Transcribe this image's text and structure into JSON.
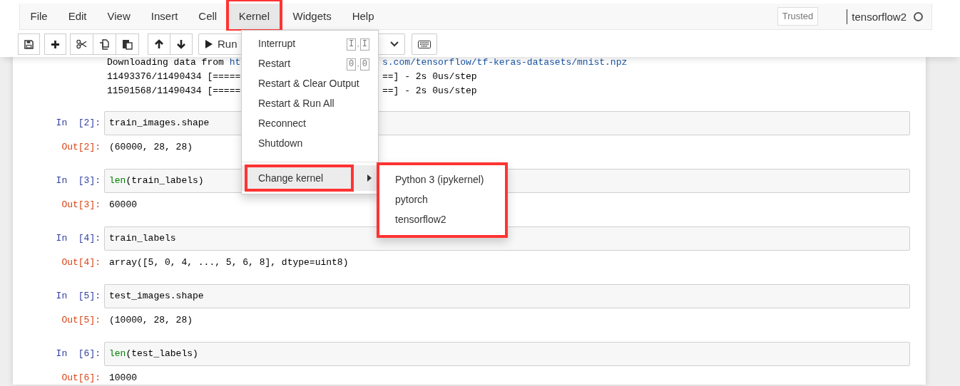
{
  "menubar": {
    "items": [
      {
        "label": "File",
        "selected": false,
        "annotated": false
      },
      {
        "label": "Edit",
        "selected": false,
        "annotated": false
      },
      {
        "label": "View",
        "selected": false,
        "annotated": false
      },
      {
        "label": "Insert",
        "selected": false,
        "annotated": false
      },
      {
        "label": "Cell",
        "selected": false,
        "annotated": false
      },
      {
        "label": "Kernel",
        "selected": true,
        "annotated": true
      },
      {
        "label": "Widgets",
        "selected": false,
        "annotated": false
      },
      {
        "label": "Help",
        "selected": false,
        "annotated": false
      }
    ],
    "trusted": "Trusted",
    "kernel_name": "tensorflow2",
    "kernel_busy": false
  },
  "toolbar": {
    "run_label": "Run"
  },
  "kernel_menu": {
    "items": [
      {
        "kind": "item",
        "label": "Interrupt",
        "shortcut": {
          "keys": [
            "I",
            "I"
          ],
          "separator": ","
        }
      },
      {
        "kind": "item",
        "label": "Restart",
        "shortcut": {
          "keys": [
            "0",
            "0"
          ],
          "separator": ","
        }
      },
      {
        "kind": "item",
        "label": "Restart & Clear Output"
      },
      {
        "kind": "item",
        "label": "Restart & Run All"
      },
      {
        "kind": "item",
        "label": "Reconnect"
      },
      {
        "kind": "item",
        "label": "Shutdown"
      },
      {
        "kind": "divider"
      },
      {
        "kind": "submenu",
        "label": "Change kernel",
        "expanded": true,
        "annotated": true
      }
    ]
  },
  "kernel_submenu": {
    "annotated": true,
    "items": [
      {
        "label": "Python 3 (ipykernel)"
      },
      {
        "label": "pytorch"
      },
      {
        "label": "tensorflow2"
      }
    ]
  },
  "cells": [
    {
      "kind": "stream",
      "lines": [
        {
          "left": [
            {
              "text": "Downloading data from ",
              "link": false
            },
            {
              "text": "ht",
              "link": true
            }
          ],
          "right": [
            {
              "text": "s.com/tensorflow/tf-keras-datasets/mnist.npz",
              "link": true
            }
          ]
        },
        {
          "left": [
            {
              "text": "11493376/11490434 [=====",
              "link": false
            }
          ],
          "right": [
            {
              "text": "==] - 2s 0us/step",
              "link": false
            }
          ]
        },
        {
          "left": [
            {
              "text": "11501568/11490434 [=====",
              "link": false
            }
          ],
          "right": [
            {
              "text": "==] - 2s 0us/step",
              "link": false
            }
          ]
        }
      ]
    },
    {
      "kind": "code",
      "in_prompt": "In  [2]:",
      "input": [
        {
          "text": "train_images.shape",
          "kind": "plain"
        }
      ],
      "out_prompt": "Out[2]:",
      "output": "(60000, 28, 28)"
    },
    {
      "kind": "code",
      "in_prompt": "In  [3]:",
      "input": [
        {
          "text": "len",
          "kind": "builtin"
        },
        {
          "text": "(train_labels)",
          "kind": "plain"
        }
      ],
      "out_prompt": "Out[3]:",
      "output": "60000"
    },
    {
      "kind": "code",
      "in_prompt": "In  [4]:",
      "input": [
        {
          "text": "train_labels",
          "kind": "plain"
        }
      ],
      "out_prompt": "Out[4]:",
      "output": "array([5, 0, 4, ..., 5, 6, 8], dtype=uint8)"
    },
    {
      "kind": "code",
      "in_prompt": "In  [5]:",
      "input": [
        {
          "text": "test_images.shape",
          "kind": "plain"
        }
      ],
      "out_prompt": "Out[5]:",
      "output": "(10000, 28, 28)"
    },
    {
      "kind": "code",
      "in_prompt": "In  [6]:",
      "input": [
        {
          "text": "len",
          "kind": "builtin"
        },
        {
          "text": "(test_labels)",
          "kind": "plain"
        }
      ],
      "out_prompt": "Out[6]:",
      "output": "10000"
    }
  ]
}
